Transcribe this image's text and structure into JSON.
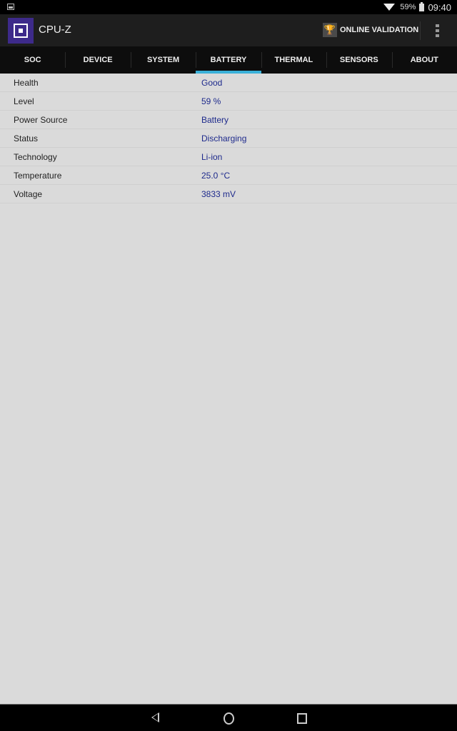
{
  "status_bar": {
    "battery_percent": "59%",
    "time": "09:40"
  },
  "app_bar": {
    "title": "CPU-Z",
    "validation_label": "ONLINE VALIDATION"
  },
  "tabs": [
    {
      "label": "SOC",
      "active": false
    },
    {
      "label": "DEVICE",
      "active": false
    },
    {
      "label": "SYSTEM",
      "active": false
    },
    {
      "label": "BATTERY",
      "active": true
    },
    {
      "label": "THERMAL",
      "active": false
    },
    {
      "label": "SENSORS",
      "active": false
    },
    {
      "label": "ABOUT",
      "active": false
    }
  ],
  "battery": [
    {
      "key": "Health",
      "value": "Good"
    },
    {
      "key": "Level",
      "value": "59 %"
    },
    {
      "key": "Power Source",
      "value": "Battery"
    },
    {
      "key": "Status",
      "value": "Discharging"
    },
    {
      "key": "Technology",
      "value": "Li-ion"
    },
    {
      "key": "Temperature",
      "value": "25.0 °C"
    },
    {
      "key": "Voltage",
      "value": "3833 mV"
    }
  ],
  "colors": {
    "accent": "#3ab0d8",
    "value_text": "#1e2a8c",
    "logo_bg": "#3d2a8a"
  }
}
